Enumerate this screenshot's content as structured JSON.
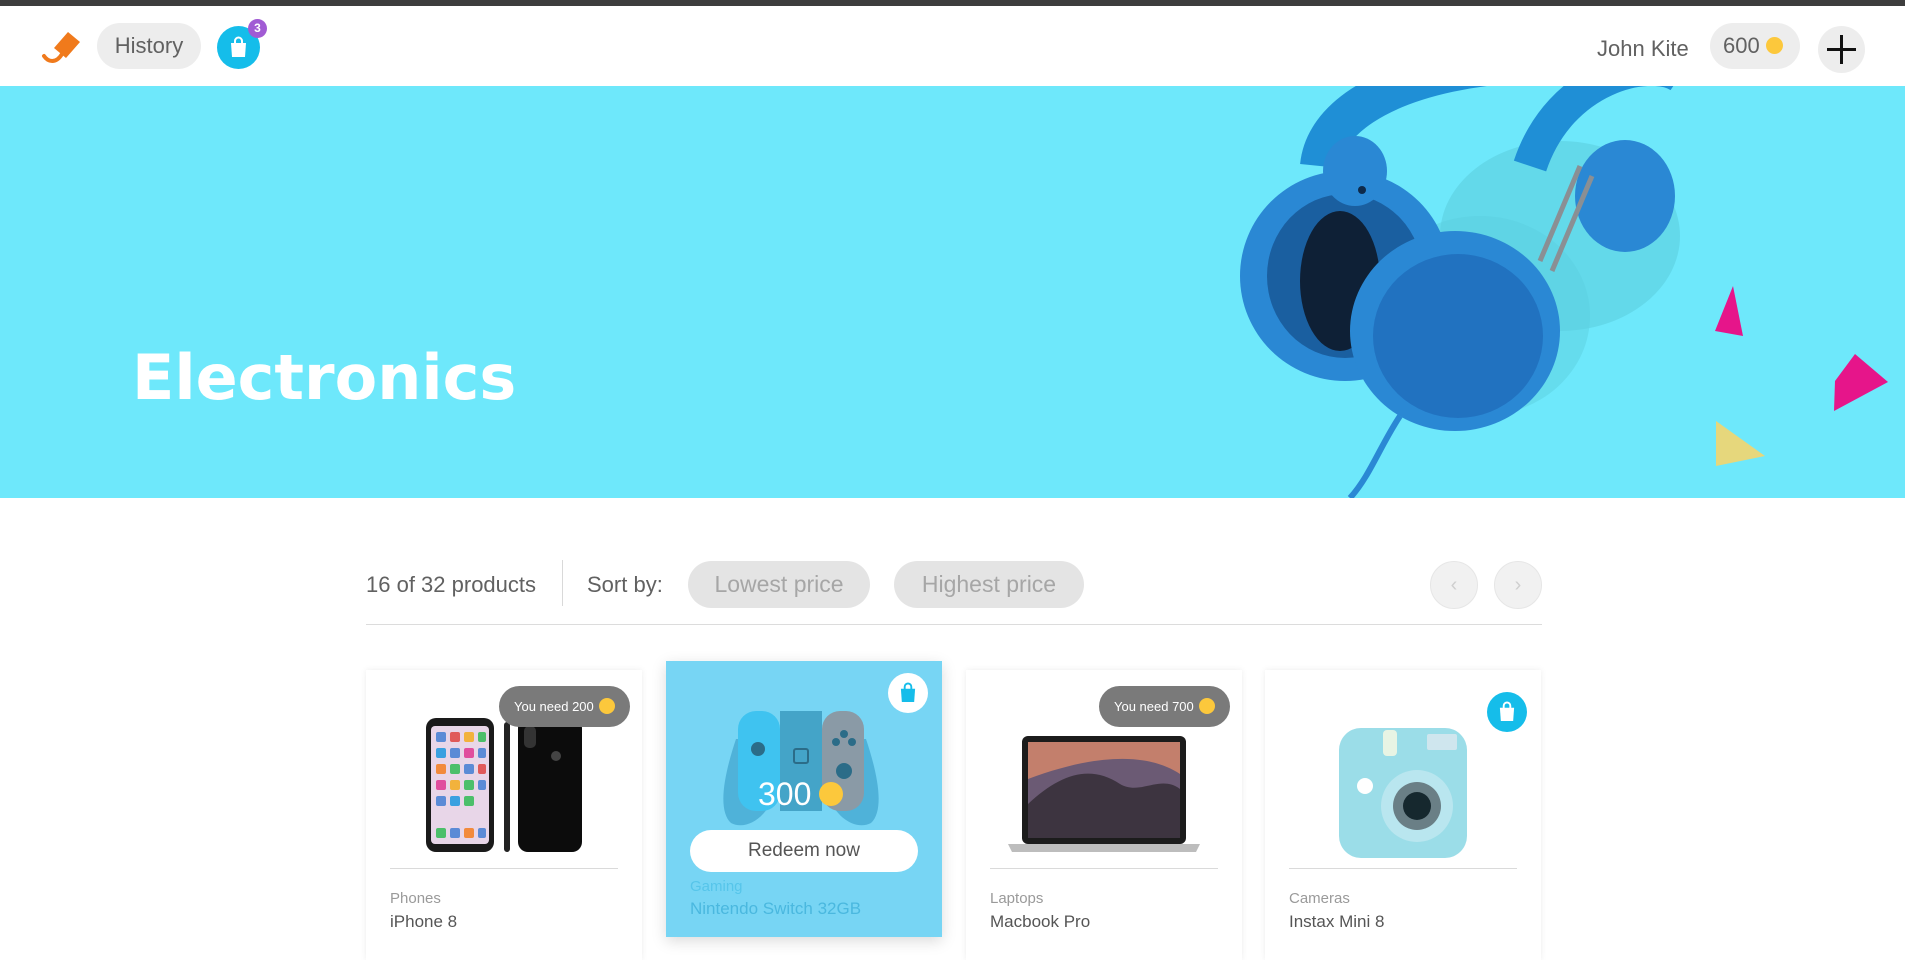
{
  "header": {
    "history_label": "History",
    "cart_count": "3",
    "user_name": "John Kite",
    "balance": "600"
  },
  "hero": {
    "title": "Electronics"
  },
  "toolbar": {
    "count_text": "16 of 32 products",
    "sort_label": "Sort by:",
    "sort_low": "Lowest price",
    "sort_high": "Highest price"
  },
  "products": [
    {
      "category": "Phones",
      "name": "iPhone 8",
      "need_text": "You need 200"
    },
    {
      "category": "Gaming",
      "name": "Nintendo Switch 32GB",
      "price": "300",
      "action": "Redeem now"
    },
    {
      "category": "Laptops",
      "name": "Macbook Pro",
      "need_text": "You need 700"
    },
    {
      "category": "Cameras",
      "name": "Instax Mini 8"
    }
  ],
  "colors": {
    "accent": "#15bdea",
    "hero_bg": "#6ee8fb",
    "coin": "#fcc83c",
    "badge": "#a15bd4",
    "active_card": "#77d5f4"
  },
  "icons": [
    "logo-icon",
    "shopping-bag-icon",
    "coin-icon",
    "plus-icon",
    "chevron-left-icon",
    "chevron-right-icon"
  ]
}
